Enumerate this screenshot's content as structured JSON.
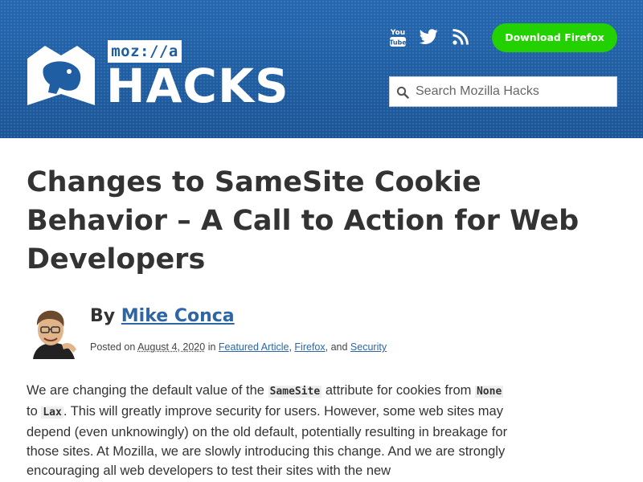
{
  "header": {
    "logo_badge": "moz://a",
    "logo_word": "HACKS",
    "download_button": "Download Firefox",
    "search_placeholder": "Search Mozilla Hacks",
    "social_icons": [
      "youtube-icon",
      "twitter-icon",
      "rss-icon"
    ],
    "youtube_text_top": "You",
    "youtube_text_bottom": "Tube",
    "colors": {
      "header_bg": "#1f5ea3",
      "button_bg": "#24d100",
      "link": "#2e66a5"
    }
  },
  "article": {
    "title": "Changes to SameSite Cookie Behavior – A Call to Action for Web Developers",
    "byline_prefix": "By",
    "author": "Mike Conca",
    "posted_prefix": "Posted on",
    "date": "August 4, 2020",
    "in_text": "in",
    "categories": [
      "Featured Article",
      "Firefox",
      "Security"
    ],
    "sep_comma": ",",
    "and_text": ", and",
    "paragraph": {
      "p1": "We are changing the default value of the",
      "code1": "SameSite",
      "p2": "attribute for cookies from",
      "code2": "None",
      "p3": "to",
      "code3": "Lax",
      "p4": ". This will greatly improve security for users. However, some web sites may depend (even unknowingly) on the old default, potentially resulting in breakage for those sites. At Mozilla, we are slowly introducing this change. And we are strongly encouraging all web developers to test their sites with the new"
    }
  }
}
